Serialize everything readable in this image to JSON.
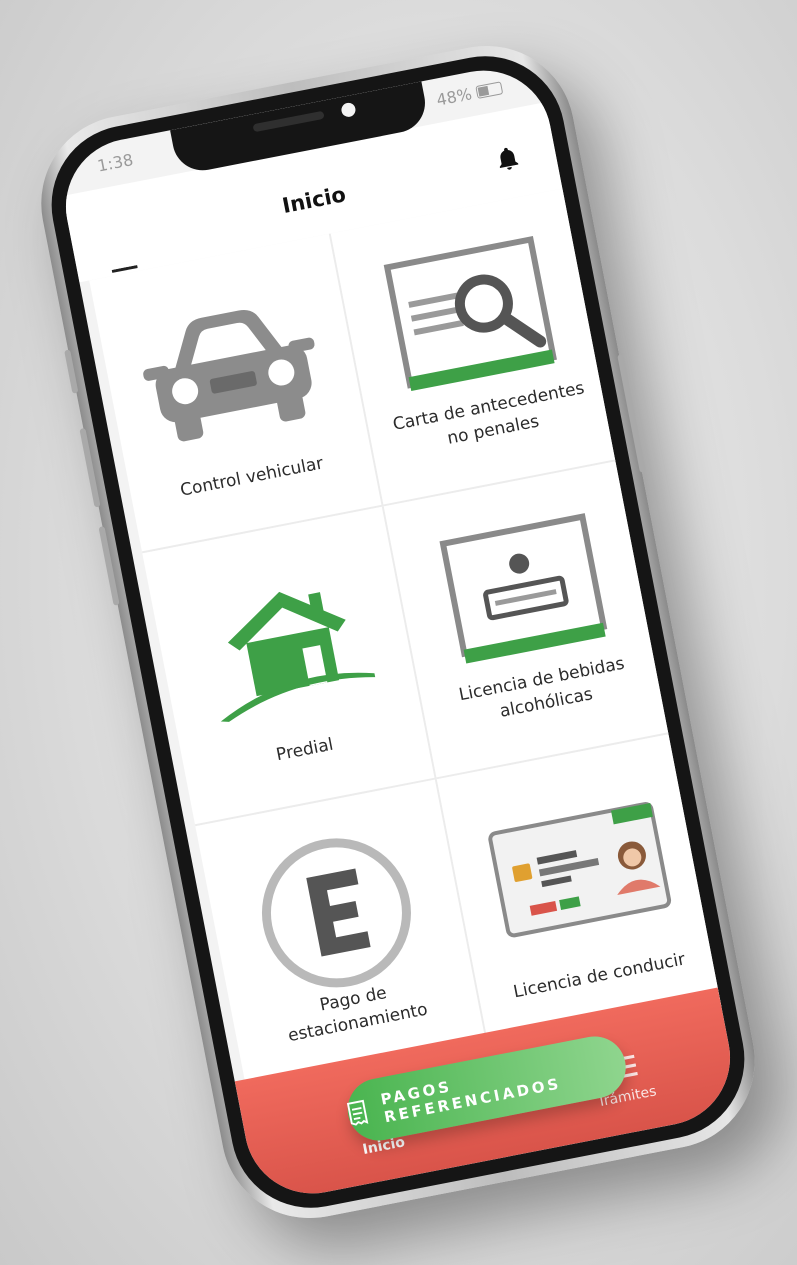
{
  "status_bar": {
    "time": "1:38",
    "battery": "48%"
  },
  "header": {
    "title": "Inicio"
  },
  "tiles": [
    {
      "label_lines": [
        "Control vehicular"
      ],
      "icon": "car-icon"
    },
    {
      "label_lines": [
        "Carta de antecedentes",
        "no penales"
      ],
      "icon": "document-search-icon"
    },
    {
      "label_lines": [
        "Predial"
      ],
      "icon": "house-icon"
    },
    {
      "label_lines": [
        "Licencia de bebidas",
        "alcohólicas"
      ],
      "icon": "license-id-icon"
    },
    {
      "label_lines": [
        "Pago de",
        "estacionamiento"
      ],
      "icon": "parking-icon"
    },
    {
      "label_lines": [
        "Licencia de conducir"
      ],
      "icon": "driver-license-icon"
    }
  ],
  "fab": {
    "label": "PAGOS REFERENCIADOS",
    "icon": "receipt-icon"
  },
  "tabbar": {
    "tabs": [
      {
        "label": "Inicio",
        "icon": "home-icon",
        "active": true
      },
      {
        "label": "Trámites",
        "icon": "list-icon",
        "active": false
      }
    ]
  },
  "colors": {
    "accent_green": "#3ea047",
    "tabbar_red": "#e45c50",
    "icon_gray": "#8a8a8a"
  }
}
